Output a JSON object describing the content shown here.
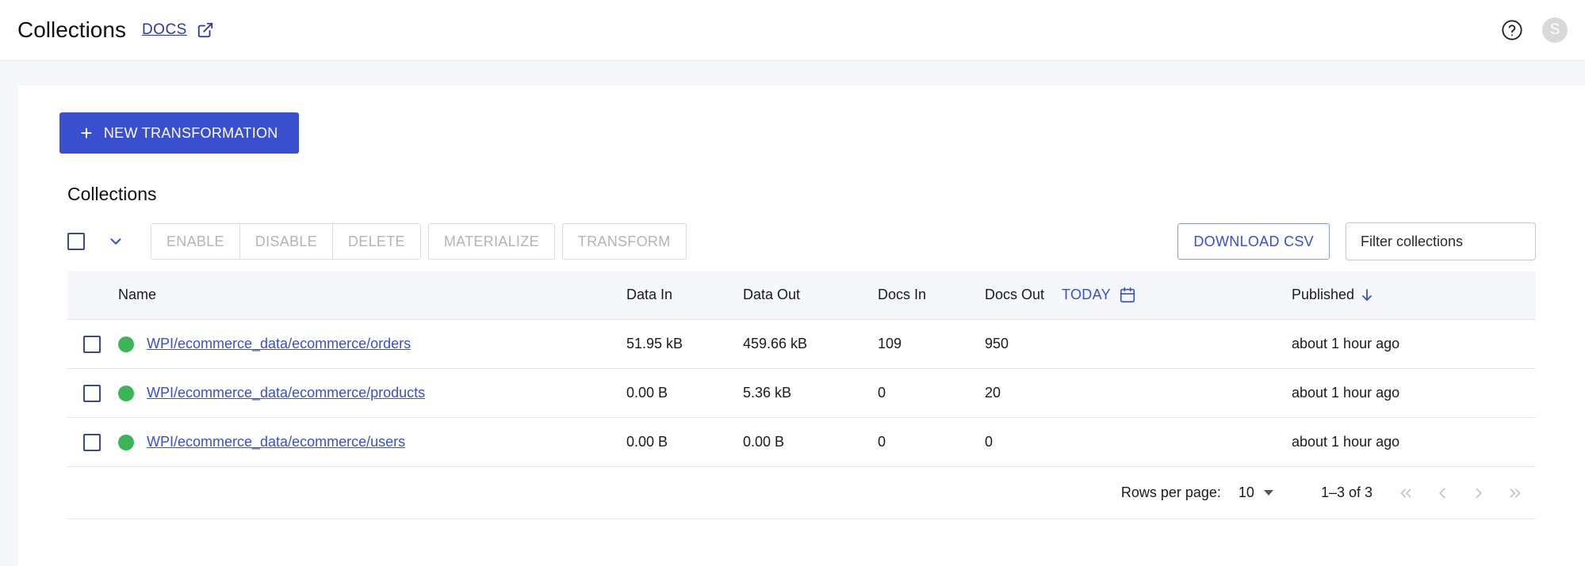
{
  "header": {
    "title": "Collections",
    "docs_label": "DOCS",
    "avatar_letter": "S"
  },
  "actions": {
    "new_transformation": "NEW TRANSFORMATION"
  },
  "section": {
    "title": "Collections"
  },
  "toolbar": {
    "enable": "ENABLE",
    "disable": "DISABLE",
    "delete": "DELETE",
    "materialize": "MATERIALIZE",
    "transform": "TRANSFORM",
    "download_csv": "DOWNLOAD CSV",
    "filter_placeholder": "Filter collections"
  },
  "table": {
    "columns": {
      "name": "Name",
      "data_in": "Data In",
      "data_out": "Data Out",
      "docs_in": "Docs In",
      "docs_out": "Docs Out",
      "range": "TODAY",
      "published": "Published"
    },
    "rows": [
      {
        "name": "WPI/ecommerce_data/ecommerce/orders",
        "data_in": "51.95 kB",
        "data_out": "459.66 kB",
        "docs_in": "109",
        "docs_out": "950",
        "published": "about 1 hour ago",
        "status_color": "#3cb55a"
      },
      {
        "name": "WPI/ecommerce_data/ecommerce/products",
        "data_in": "0.00 B",
        "data_out": "5.36 kB",
        "docs_in": "0",
        "docs_out": "20",
        "published": "about 1 hour ago",
        "status_color": "#3cb55a"
      },
      {
        "name": "WPI/ecommerce_data/ecommerce/users",
        "data_in": "0.00 B",
        "data_out": "0.00 B",
        "docs_in": "0",
        "docs_out": "0",
        "published": "about 1 hour ago",
        "status_color": "#3cb55a"
      }
    ]
  },
  "pagination": {
    "rows_per_page_label": "Rows per page:",
    "rows_per_page_value": "10",
    "range": "1–3 of 3"
  },
  "colors": {
    "accent": "#3a4fd0",
    "status_ok": "#3cb55a"
  }
}
